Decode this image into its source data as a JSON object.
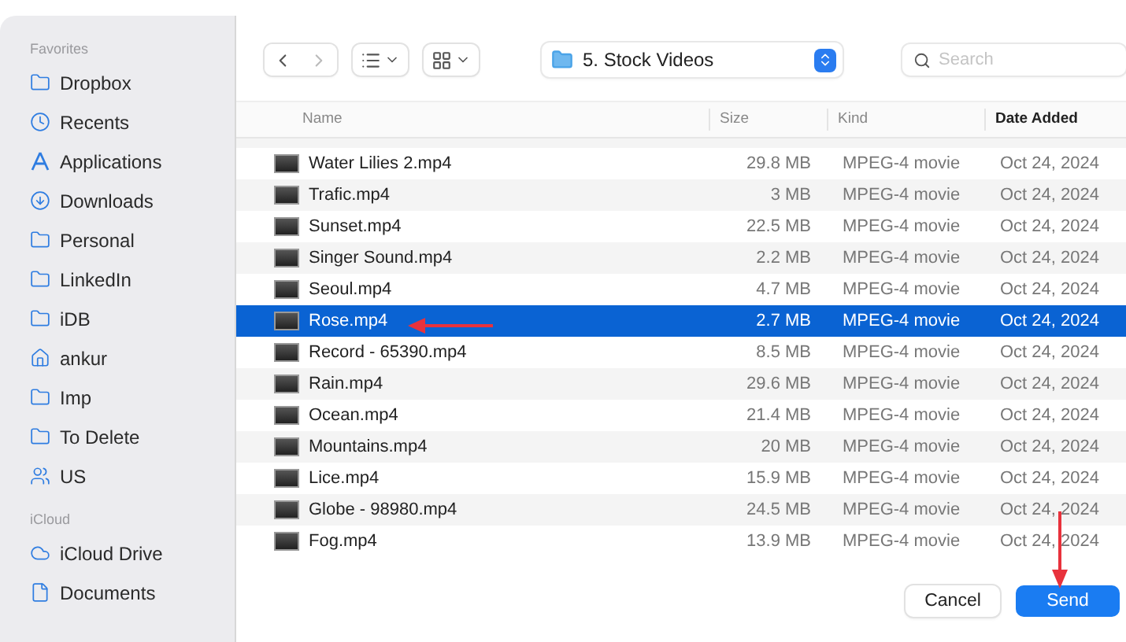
{
  "sidebar": {
    "sections": [
      {
        "title": "Favorites",
        "items": [
          {
            "label": "Dropbox",
            "kind": "folder"
          },
          {
            "label": "Recents",
            "kind": "recents"
          },
          {
            "label": "Applications",
            "kind": "apps"
          },
          {
            "label": "Downloads",
            "kind": "downloads"
          },
          {
            "label": "Personal",
            "kind": "folder"
          },
          {
            "label": "LinkedIn",
            "kind": "folder"
          },
          {
            "label": "iDB",
            "kind": "folder"
          },
          {
            "label": "ankur",
            "kind": "home"
          },
          {
            "label": "Imp",
            "kind": "folder"
          },
          {
            "label": "To Delete",
            "kind": "folder"
          },
          {
            "label": "US",
            "kind": "shared"
          }
        ]
      },
      {
        "title": "iCloud",
        "items": [
          {
            "label": "iCloud Drive",
            "kind": "cloud"
          },
          {
            "label": "Documents",
            "kind": "document"
          }
        ]
      }
    ]
  },
  "toolbar": {
    "location": "5. Stock Videos",
    "search": {
      "placeholder": "Search"
    }
  },
  "table": {
    "columns": [
      {
        "label": "Name",
        "sorted": false
      },
      {
        "label": "Size",
        "sorted": false
      },
      {
        "label": "Kind",
        "sorted": false
      },
      {
        "label": "Date Added",
        "sorted": true
      }
    ],
    "rows": [
      {
        "name": "Water Lilies 2.mp4",
        "size": "29.8 MB",
        "kind": "MPEG-4 movie",
        "date": "Oct 24, 2024",
        "selected": false
      },
      {
        "name": "Trafic.mp4",
        "size": "3 MB",
        "kind": "MPEG-4 movie",
        "date": "Oct 24, 2024",
        "selected": false
      },
      {
        "name": "Sunset.mp4",
        "size": "22.5 MB",
        "kind": "MPEG-4 movie",
        "date": "Oct 24, 2024",
        "selected": false
      },
      {
        "name": "Singer Sound.mp4",
        "size": "2.2 MB",
        "kind": "MPEG-4 movie",
        "date": "Oct 24, 2024",
        "selected": false
      },
      {
        "name": "Seoul.mp4",
        "size": "4.7 MB",
        "kind": "MPEG-4 movie",
        "date": "Oct 24, 2024",
        "selected": false
      },
      {
        "name": "Rose.mp4",
        "size": "2.7 MB",
        "kind": "MPEG-4 movie",
        "date": "Oct 24, 2024",
        "selected": true
      },
      {
        "name": "Record - 65390.mp4",
        "size": "8.5 MB",
        "kind": "MPEG-4 movie",
        "date": "Oct 24, 2024",
        "selected": false
      },
      {
        "name": "Rain.mp4",
        "size": "29.6 MB",
        "kind": "MPEG-4 movie",
        "date": "Oct 24, 2024",
        "selected": false
      },
      {
        "name": "Ocean.mp4",
        "size": "21.4 MB",
        "kind": "MPEG-4 movie",
        "date": "Oct 24, 2024",
        "selected": false
      },
      {
        "name": "Mountains.mp4",
        "size": "20 MB",
        "kind": "MPEG-4 movie",
        "date": "Oct 24, 2024",
        "selected": false
      },
      {
        "name": "Lice.mp4",
        "size": "15.9 MB",
        "kind": "MPEG-4 movie",
        "date": "Oct 24, 2024",
        "selected": false
      },
      {
        "name": "Globe - 98980.mp4",
        "size": "24.5 MB",
        "kind": "MPEG-4 movie",
        "date": "Oct 24, 2024",
        "selected": false
      },
      {
        "name": "Fog.mp4",
        "size": "13.9 MB",
        "kind": "MPEG-4 movie",
        "date": "Oct 24, 2024",
        "selected": false
      }
    ]
  },
  "buttons": [
    {
      "label": "Cancel",
      "kind": "secondary"
    },
    {
      "label": "Send",
      "kind": "primary"
    }
  ]
}
